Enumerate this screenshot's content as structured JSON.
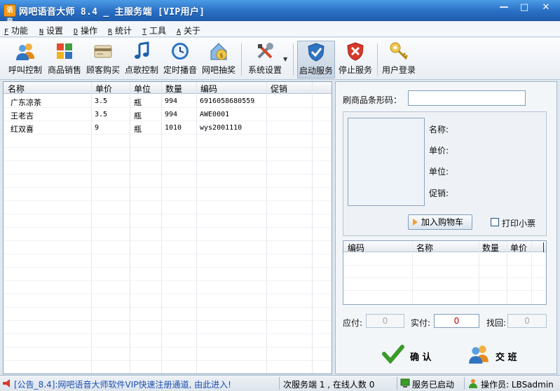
{
  "window": {
    "icon_text": "语音",
    "title": "网吧语音大师 8.4 _ 主服务端 [VIP用户]",
    "minimize": "—",
    "maximize": "□",
    "close": "✕"
  },
  "menu": [
    {
      "key": "F",
      "label": "功能"
    },
    {
      "key": "N",
      "label": "设置"
    },
    {
      "key": "D",
      "label": "操作"
    },
    {
      "key": "R",
      "label": "统计"
    },
    {
      "key": "T",
      "label": "工具"
    },
    {
      "key": "A",
      "label": "关于"
    }
  ],
  "toolbar": [
    {
      "label": "呼叫控制",
      "icon": "users-icon"
    },
    {
      "label": "商品销售",
      "icon": "cube-icon"
    },
    {
      "label": "顾客购买",
      "icon": "card-icon"
    },
    {
      "label": "点歌控制",
      "icon": "music-icon"
    },
    {
      "label": "定时播音",
      "icon": "clock-icon"
    },
    {
      "label": "网吧抽奖",
      "icon": "money-bag-icon"
    },
    {
      "label": "系统设置",
      "icon": "tools-icon"
    },
    {
      "label": "启动服务",
      "icon": "shield-check-icon"
    },
    {
      "label": "停止服务",
      "icon": "shield-x-icon"
    },
    {
      "label": "用户登录",
      "icon": "key-icon"
    }
  ],
  "product_list": {
    "columns": [
      "名称",
      "单价",
      "单位",
      "数量",
      "编码",
      "促销"
    ],
    "rows": [
      [
        "广东凉茶",
        "3.5",
        "瓶",
        "994",
        "6916058680559",
        ""
      ],
      [
        "王老吉",
        "3.5",
        "瓶",
        "994",
        "AWE0001",
        ""
      ],
      [
        "红双喜",
        "9",
        "瓶",
        "1010",
        "wys2001110",
        ""
      ]
    ]
  },
  "scan": {
    "label": "刷商品条形码：",
    "value": ""
  },
  "product_detail": {
    "name_label": "名称:",
    "price_label": "单价:",
    "unit_label": "单位:",
    "promo_label": "促销:"
  },
  "cart": {
    "add_button": "加入购物车",
    "print_receipt": "打印小票",
    "columns": [
      "编码",
      "名称",
      "数量",
      "单价"
    ]
  },
  "payment": {
    "due_label": "应付:",
    "due_value": "0",
    "paid_label": "实付:",
    "paid_value": "0",
    "change_label": "找回:",
    "change_value": "0"
  },
  "actions": {
    "confirm": "确 认",
    "handover": "交 班"
  },
  "status": {
    "announcement": "[公告_8.4]:网吧语音大师软件VIP快速注册通道, 由此进入!",
    "sessions": "次服务端 1 ,  在线人数 0",
    "service_state": "服务已启动",
    "operator": "操作员: LBSadmin"
  },
  "colors": {
    "title_bar": "#2a6fc4",
    "amount_red": "#c00000"
  }
}
